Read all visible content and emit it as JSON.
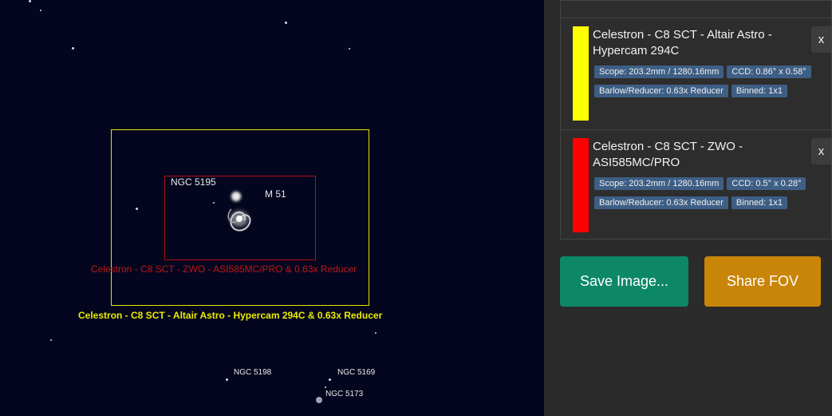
{
  "sky": {
    "objects": {
      "ngc5195": "NGC 5195",
      "m51": "M 51",
      "ngc5198": "NGC 5198",
      "ngc5169": "NGC 5169",
      "ngc5173": "NGC 5173"
    },
    "fov_captions": {
      "red": "Celestron - C8 SCT - ZWO - ASI585MC/PRO  & 0.63x Reducer",
      "yellow": "Celestron - C8 SCT - Altair Astro - Hypercam 294C  & 0.63x Reducer"
    }
  },
  "equipment_list": [
    {
      "color": "#ffff00",
      "title": "Celestron - C8 SCT - Altair Astro - Hypercam 294C",
      "close_label": "x",
      "scope": "Scope: 203.2mm / 1280.16mm",
      "ccd": "CCD: 0.86° x 0.58°",
      "barlow": "Barlow/Reducer: 0.63x Reducer",
      "binned": "Binned: 1x1"
    },
    {
      "color": "#ff0000",
      "title": "Celestron - C8 SCT - ZWO - ASI585MC/PRO",
      "close_label": "x",
      "scope": "Scope: 203.2mm / 1280.16mm",
      "ccd": "CCD: 0.5° x 0.28°",
      "barlow": "Barlow/Reducer: 0.63x Reducer",
      "binned": "Binned: 1x1"
    }
  ],
  "buttons": {
    "save": "Save Image...",
    "share": "Share FOV"
  }
}
